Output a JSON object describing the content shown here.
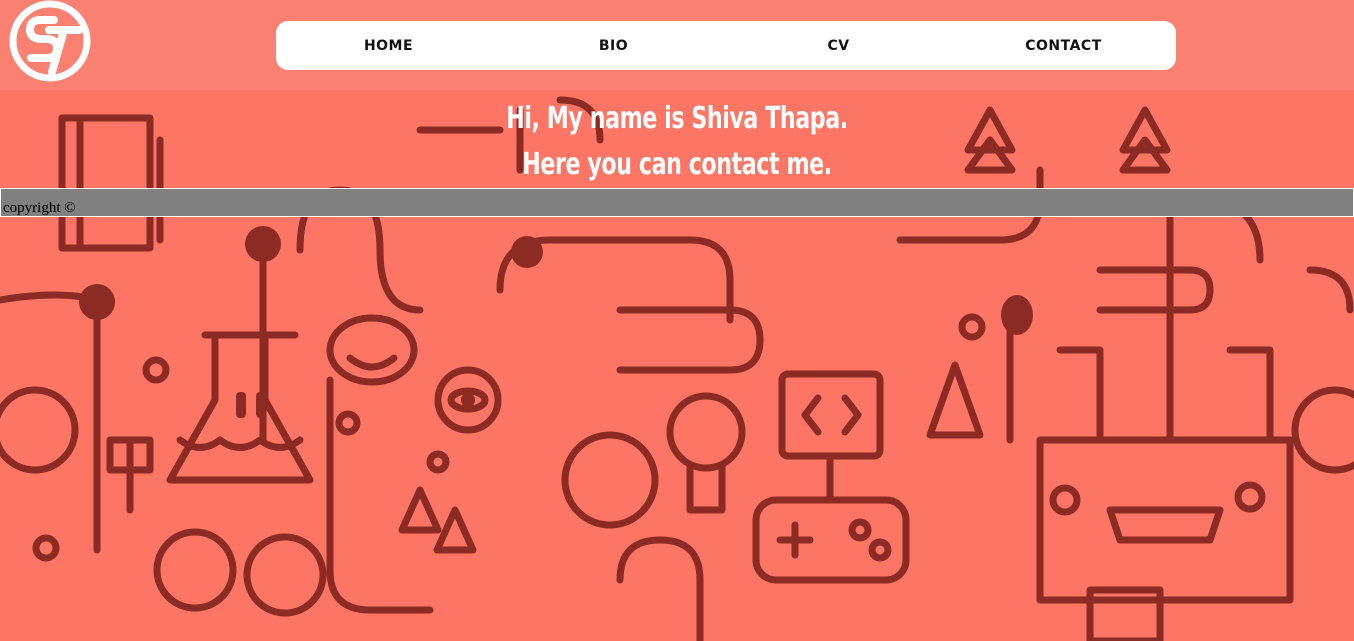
{
  "nav": {
    "items": [
      {
        "label": "HOME"
      },
      {
        "label": "BIO"
      },
      {
        "label": "CV"
      },
      {
        "label": "CONTACT"
      }
    ]
  },
  "hero": {
    "line1": "Hi, My name is Shiva Thapa.",
    "line2": "Here you can contact me."
  },
  "footer": {
    "copyright": "copyright ©"
  },
  "colors": {
    "header_bg": "#fa8171",
    "page_bg": "#fd7565",
    "doodle_stroke": "#8b2b24",
    "footer_bg": "#808080"
  },
  "logo": {
    "icon": "st-monogram-logo"
  }
}
